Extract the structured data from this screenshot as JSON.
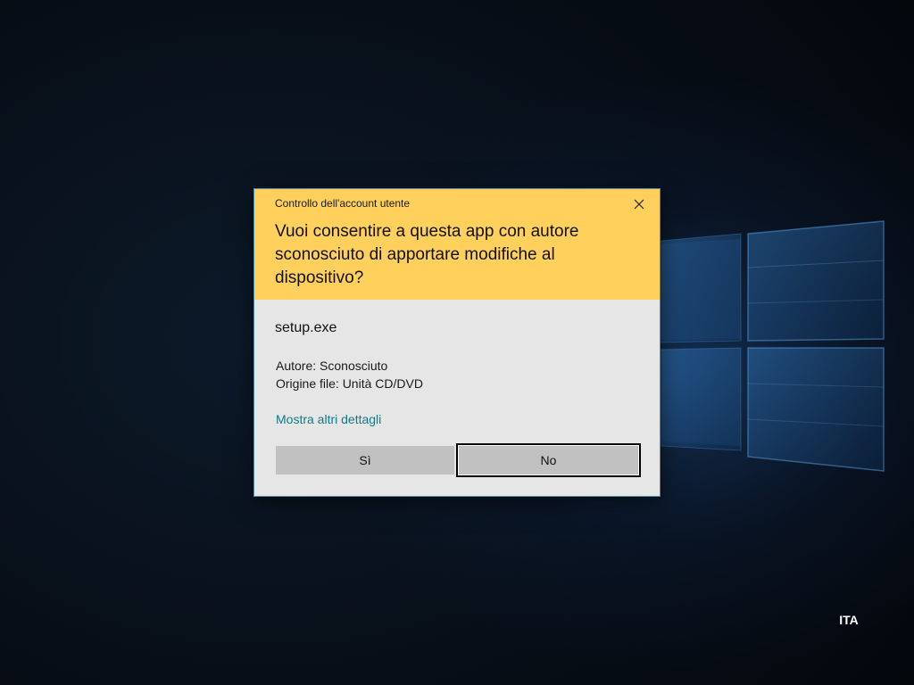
{
  "desktop": {
    "language_indicator": "ITA"
  },
  "dialog": {
    "title": "Controllo dell'account utente",
    "question": "Vuoi consentire a questa app con autore sconosciuto di apportare modifiche al dispositivo?",
    "app_name": "setup.exe",
    "publisher_line": "Autore: Sconosciuto",
    "origin_line": "Origine file: Unità CD/DVD",
    "more_details_link": "Mostra altri dettagli",
    "yes_button": "Sì",
    "no_button": "No",
    "close_icon": "close-icon"
  },
  "colors": {
    "header_bg": "#ffd05b",
    "body_bg": "#e6e6e6",
    "button_bg": "#c1c1c1",
    "link": "#0e7c86",
    "dialog_border": "#4a8fa3"
  }
}
